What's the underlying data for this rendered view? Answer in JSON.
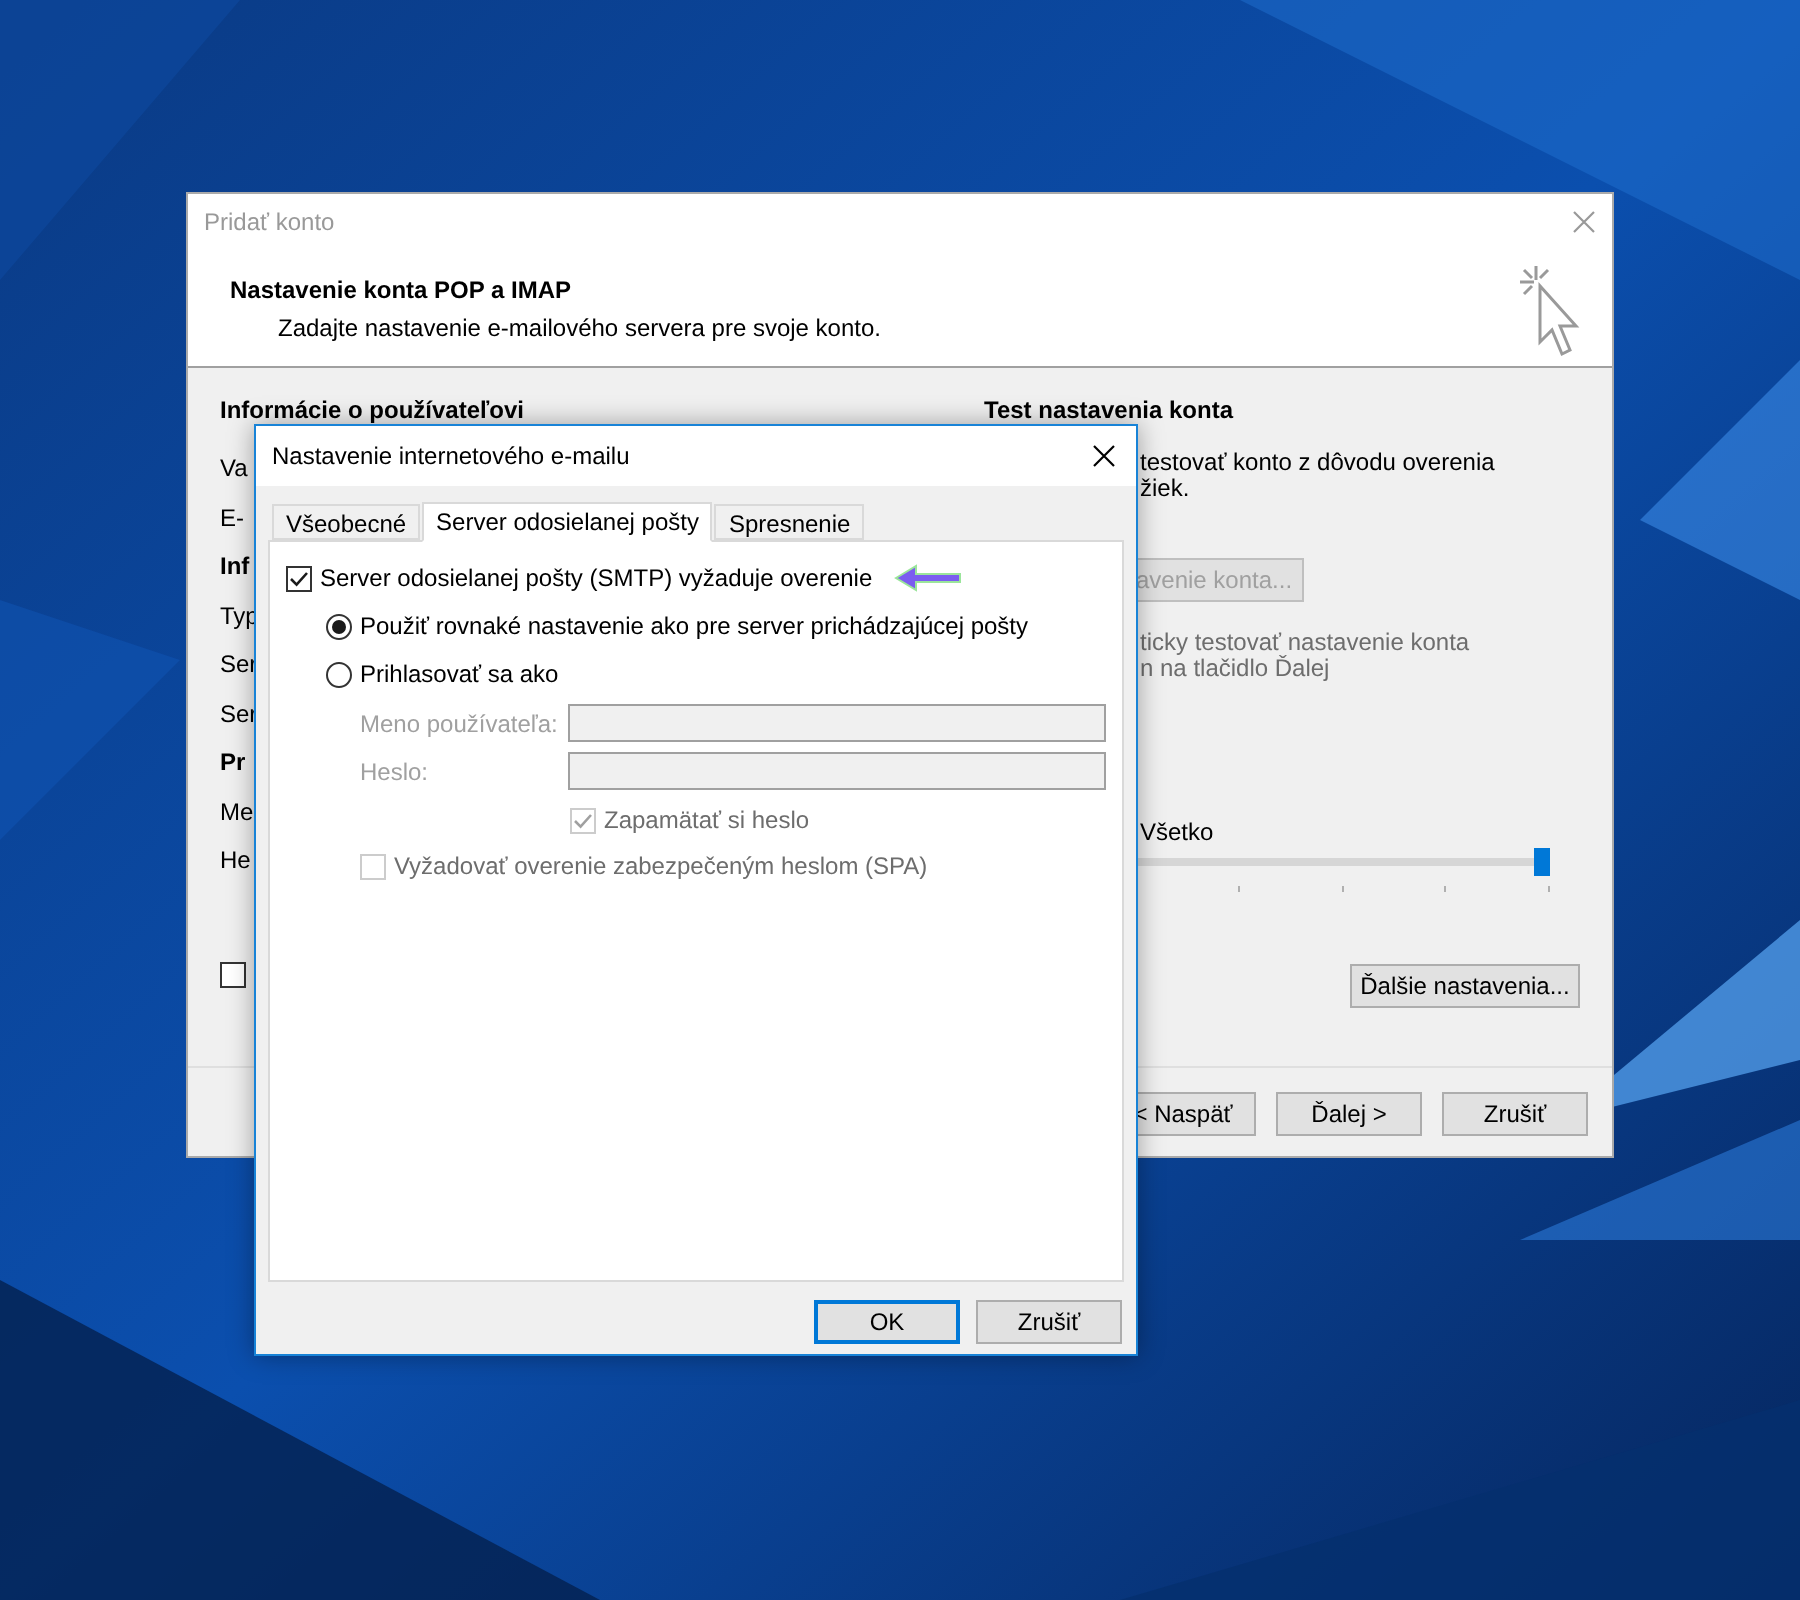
{
  "back_window": {
    "title": "Pridať konto",
    "heading": "Nastavenie konta POP a IMAP",
    "subheading": "Zadajte nastavenie e-mailového servera pre svoje konto.",
    "left_section": {
      "title": "Informácie o používateľovi",
      "rows": [
        {
          "kind": "label",
          "text": "Va"
        },
        {
          "kind": "label",
          "text": "E-"
        },
        {
          "kind": "section",
          "text": "Inf"
        },
        {
          "kind": "label",
          "text": "Typ"
        },
        {
          "kind": "label",
          "text": "Ser"
        },
        {
          "kind": "label",
          "text": "Ser"
        },
        {
          "kind": "section",
          "text": "Pr"
        },
        {
          "kind": "label",
          "text": "Me"
        },
        {
          "kind": "label",
          "text": "He"
        }
      ],
      "checkbox": {
        "checked": false
      }
    },
    "right_section": {
      "title": "Test nastavenia konta",
      "lines": [
        "testovať konto z dôvodu overenia",
        "žiek."
      ],
      "test_button": {
        "label": "avenie konta...",
        "disabled": true
      },
      "auto_test": {
        "lines": [
          "ticky testovať nastavenie konta",
          "n na tlačidlo Ďalej"
        ],
        "disabled": true
      },
      "slider": {
        "label": "Všetko",
        "level": 1
      }
    },
    "more_settings_button": "Ďalšie nastavenia...",
    "buttons": [
      "< Naspäť",
      "Ďalej >",
      "Zrušiť"
    ]
  },
  "dialog": {
    "title": "Nastavenie internetového e-mailu",
    "tabs": [
      {
        "label": "Všeobecné",
        "selected": false
      },
      {
        "label": "Server odosielanej pošty",
        "selected": true
      },
      {
        "label": "Spresnenie",
        "selected": false
      }
    ],
    "smtp_auth": {
      "label": "Server odosielanej pošty (SMTP) vyžaduje overenie",
      "checked": true
    },
    "options": [
      {
        "label": "Použiť rovnaké nastavenie ako pre server prichádzajúcej pošty",
        "selected": true
      },
      {
        "label": "Prihlasovať sa ako",
        "selected": false
      }
    ],
    "fields": [
      {
        "label": "Meno používateľa:",
        "disabled": true
      },
      {
        "label": "Heslo:",
        "disabled": true
      }
    ],
    "remember_password": {
      "label": "Zapamätať si heslo",
      "checked": true,
      "disabled": true
    },
    "spa": {
      "label": "Vyžadovať overenie zabezpečeným heslom (SPA)",
      "checked": false,
      "disabled": true
    },
    "buttons": [
      {
        "label": "OK",
        "default": true
      },
      {
        "label": "Zrušiť",
        "default": false
      }
    ]
  }
}
